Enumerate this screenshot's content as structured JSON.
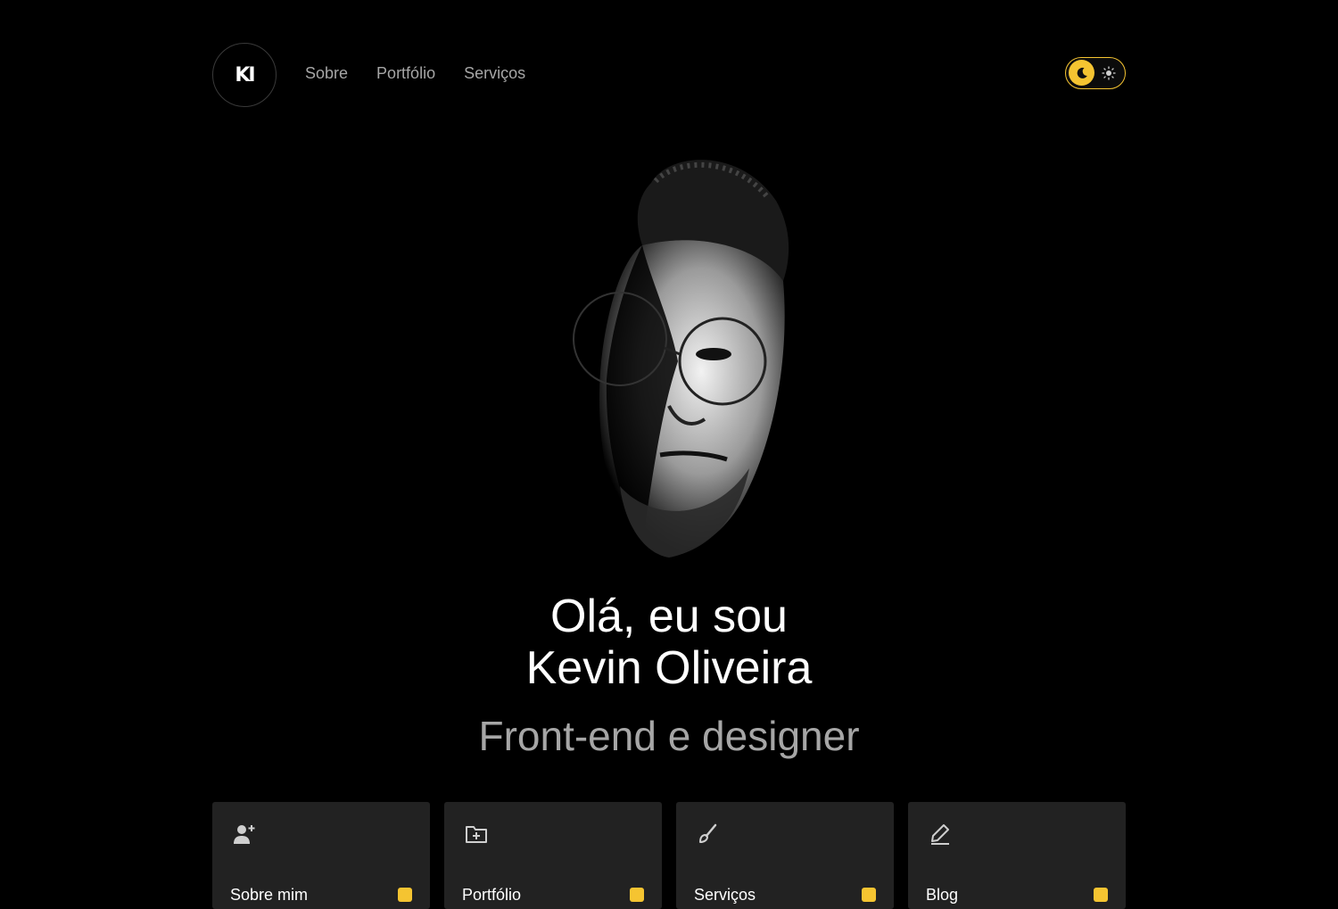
{
  "header": {
    "logo_text": "KI",
    "nav": [
      {
        "label": "Sobre"
      },
      {
        "label": "Portfólio"
      },
      {
        "label": "Serviços"
      }
    ],
    "theme_toggle": {
      "state": "dark",
      "accent": "#f5c431"
    }
  },
  "hero": {
    "title_line1": "Olá, eu sou",
    "title_line2": "Kevin Oliveira",
    "subtitle": "Front-end e designer"
  },
  "cards": [
    {
      "icon": "user-plus-icon",
      "label": "Sobre mim"
    },
    {
      "icon": "folder-plus-icon",
      "label": "Portfólio"
    },
    {
      "icon": "brush-icon",
      "label": "Serviços"
    },
    {
      "icon": "pencil-icon",
      "label": "Blog"
    }
  ],
  "colors": {
    "background": "#000000",
    "card": "#222222",
    "accent": "#f5c431",
    "muted": "#a6a6a6"
  }
}
